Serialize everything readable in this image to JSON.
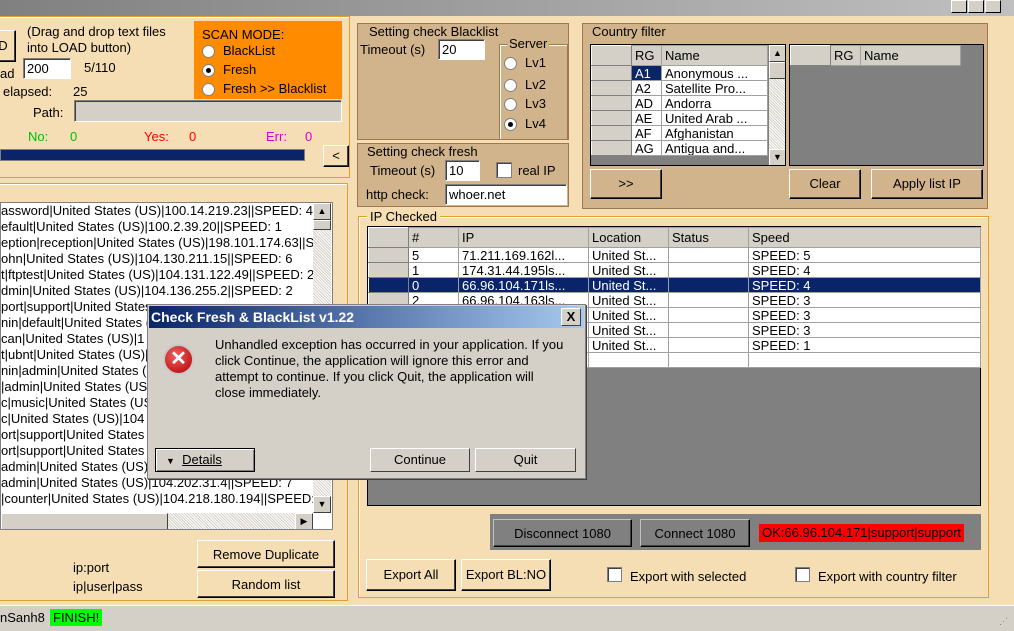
{
  "window": {
    "controls": [
      "minimize",
      "maximize",
      "close"
    ]
  },
  "load": {
    "hint": "(Drag and drop text files into LOAD button)",
    "button_label": "D",
    "thread_label": "ad",
    "thread_value": "200",
    "progress_count": "5/110",
    "elapsed_label": "elapsed:",
    "elapsed_value": "25",
    "path_label": "Path:",
    "path_value": "",
    "progress_fraction": 1.0,
    "collapse_label": "<"
  },
  "counts": {
    "no_label": "No:",
    "no_value": "0",
    "yes_label": "Yes:",
    "yes_value": "0",
    "err_label": "Err:",
    "err_value": "0"
  },
  "scan_mode": {
    "title": "SCAN MODE:",
    "options": [
      {
        "label": "BlackList",
        "selected": false
      },
      {
        "label": "Fresh",
        "selected": true
      },
      {
        "label": "Fresh >> Blacklist",
        "selected": false
      }
    ]
  },
  "blacklist_settings": {
    "title": "Setting check Blacklist",
    "timeout_label": "Timeout (s)",
    "timeout_value": "20",
    "server_title": "Server",
    "servers": [
      {
        "label": "Lv1",
        "selected": false
      },
      {
        "label": "Lv2",
        "selected": false
      },
      {
        "label": "Lv3",
        "selected": false
      },
      {
        "label": "Lv4",
        "selected": true
      }
    ]
  },
  "fresh_settings": {
    "title": "Setting check fresh",
    "timeout_label": "Timeout (s)",
    "timeout_value": "10",
    "real_ip_label": "real IP",
    "http_label": "http check:",
    "http_value": "whoer.net"
  },
  "country_filter": {
    "title": "Country filter",
    "col_rg": "RG",
    "col_name": "Name",
    "rows": [
      {
        "rg": "A1",
        "name": "Anonymous ..."
      },
      {
        "rg": "A2",
        "name": "Satellite Pro..."
      },
      {
        "rg": "AD",
        "name": "Andorra"
      },
      {
        "rg": "AE",
        "name": "United Arab ..."
      },
      {
        "rg": "AF",
        "name": "Afghanistan"
      },
      {
        "rg": "AG",
        "name": "Antigua and..."
      }
    ],
    "add_label": ">>",
    "clear_label": "Clear",
    "apply_label": "Apply list IP"
  },
  "proxy_list": [
    "assword|United States (US)|100.14.219.23||SPEED: 4",
    "efault|United States (US)|100.2.39.20||SPEED: 1",
    "eption|reception|United States (US)|198.101.174.63||SP",
    "ohn|United States (US)|104.130.211.15||SPEED: 6",
    "t|ftptest|United States (US)|104.131.122.49||SPEED: 2",
    "dmin|United States (US)|104.136.255.2||SPEED: 2",
    "port|support|United States",
    "nin|default|United States (",
    "can|United States (US)|1",
    "t|ubnt|United States (US)|",
    "nin|admin|United States (",
    "|admin|United States (US",
    "c|music|United States (US",
    "c|United States (US)|104",
    "ort|support|United States",
    "ort|support|United States",
    "admin|United States (US)",
    "admin|United States (US)|104.202.31.4||SPEED: 7",
    "|counter|United States (US)|104.218.180.194||SPEED:"
  ],
  "list_actions": {
    "format1": "ip:port",
    "format2": "ip|user|pass",
    "remove_dup_label": "Remove Duplicate",
    "random_label": "Random list"
  },
  "ip_checked": {
    "title": "IP Checked",
    "columns": [
      "#",
      "IP",
      "Location",
      "Status",
      "Speed"
    ],
    "rows": [
      {
        "n": "5",
        "ip": "71.211.169.162l...",
        "loc": "United St...",
        "status": "",
        "speed": "SPEED: 5"
      },
      {
        "n": "1",
        "ip": "174.31.44.195ls...",
        "loc": "United St...",
        "status": "",
        "speed": "SPEED: 4"
      },
      {
        "n": "0",
        "ip": "66.96.104.171ls...",
        "loc": "United St...",
        "status": "",
        "speed": "SPEED: 4",
        "selected": true
      },
      {
        "n": "2",
        "ip": "66.96.104.163ls...",
        "loc": "United St...",
        "status": "",
        "speed": "SPEED: 3"
      },
      {
        "n": "",
        "ip": "",
        "loc": "United St...",
        "status": "",
        "speed": "SPEED: 3"
      },
      {
        "n": "",
        "ip": "",
        "loc": "United St...",
        "status": "",
        "speed": "SPEED: 3"
      },
      {
        "n": "",
        "ip": "",
        "loc": "United St...",
        "status": "",
        "speed": "SPEED: 1"
      }
    ]
  },
  "connection": {
    "disconnect_label": "Disconnect 1080",
    "connect_label": "Connect 1080",
    "status": "OK:66.96.104.171|support|support"
  },
  "export": {
    "all_label": "Export All",
    "bl_label": "Export BL:NO",
    "selected_label": "Export with selected",
    "country_label": "Export with country filter"
  },
  "statusbar": {
    "user": "nSanh8",
    "state": "FINISH!"
  },
  "dialog": {
    "title": "Check Fresh & BlackList v1.22",
    "message": "Unhandled exception has occurred in your application. If you click Continue, the application will ignore this error and attempt to continue. If you click Quit, the application will close immediately.",
    "details_label": "Details",
    "continue_label": "Continue",
    "quit_label": "Quit",
    "close_label": "X"
  }
}
